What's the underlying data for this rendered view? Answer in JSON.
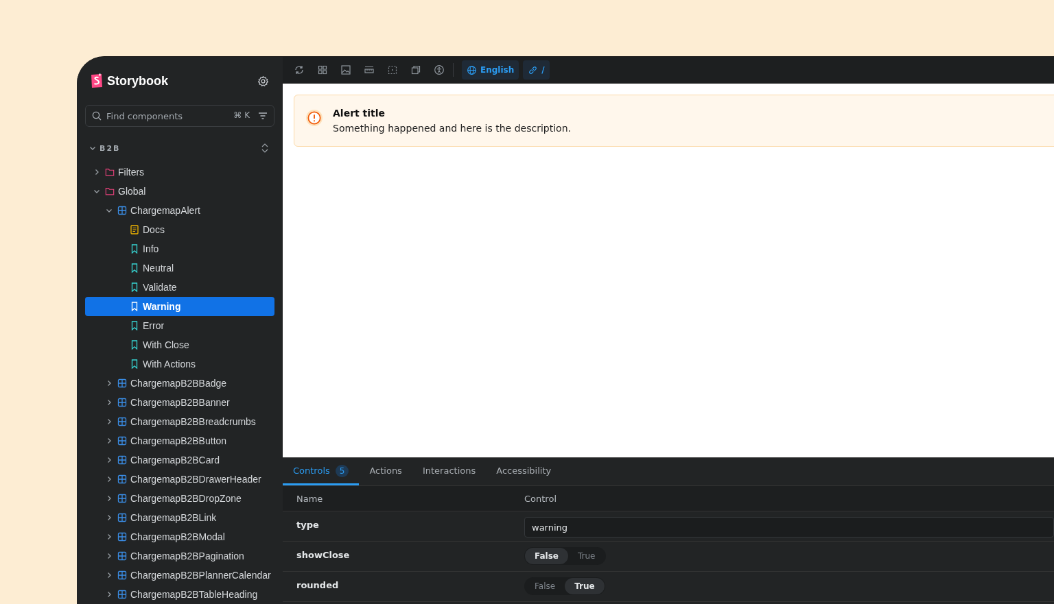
{
  "sidebar": {
    "brand": "Storybook",
    "search": {
      "placeholder": "Find components",
      "shortcut": "⌘ K"
    },
    "section": {
      "label": "B2B",
      "expanded": true
    },
    "tree": [
      {
        "label": "Filters",
        "kind": "folder",
        "expanded": false,
        "selected": false
      },
      {
        "label": "Global",
        "kind": "folder",
        "expanded": true,
        "selected": false,
        "children": [
          {
            "label": "ChargemapAlert",
            "kind": "component",
            "expanded": true,
            "selected": false,
            "children": [
              {
                "label": "Docs",
                "kind": "docs",
                "selected": false
              },
              {
                "label": "Info",
                "kind": "story",
                "selected": false
              },
              {
                "label": "Neutral",
                "kind": "story",
                "selected": false
              },
              {
                "label": "Validate",
                "kind": "story",
                "selected": false
              },
              {
                "label": "Warning",
                "kind": "story",
                "selected": true
              },
              {
                "label": "Error",
                "kind": "story",
                "selected": false
              },
              {
                "label": "With Close",
                "kind": "story",
                "selected": false
              },
              {
                "label": "With Actions",
                "kind": "story",
                "selected": false
              }
            ]
          },
          {
            "label": "ChargemapB2BBadge",
            "kind": "component",
            "expanded": false,
            "selected": false
          },
          {
            "label": "ChargemapB2BBanner",
            "kind": "component",
            "expanded": false,
            "selected": false
          },
          {
            "label": "ChargemapB2BBreadcrumbs",
            "kind": "component",
            "expanded": false,
            "selected": false
          },
          {
            "label": "ChargemapB2BButton",
            "kind": "component",
            "expanded": false,
            "selected": false
          },
          {
            "label": "ChargemapB2BCard",
            "kind": "component",
            "expanded": false,
            "selected": false
          },
          {
            "label": "ChargemapB2BDrawerHeader",
            "kind": "component",
            "expanded": false,
            "selected": false
          },
          {
            "label": "ChargemapB2BDropZone",
            "kind": "component",
            "expanded": false,
            "selected": false
          },
          {
            "label": "ChargemapB2BLink",
            "kind": "component",
            "expanded": false,
            "selected": false
          },
          {
            "label": "ChargemapB2BModal",
            "kind": "component",
            "expanded": false,
            "selected": false
          },
          {
            "label": "ChargemapB2BPagination",
            "kind": "component",
            "expanded": false,
            "selected": false
          },
          {
            "label": "ChargemapB2BPlannerCalendar",
            "kind": "component",
            "expanded": false,
            "selected": false
          },
          {
            "label": "ChargemapB2BTableHeading",
            "kind": "component",
            "expanded": false,
            "selected": false
          }
        ]
      }
    ]
  },
  "toolbar": {
    "language": "English",
    "link": "/"
  },
  "alert": {
    "title": "Alert title",
    "description": "Something happened and here is the description."
  },
  "panel": {
    "tabs": [
      {
        "label": "Controls",
        "badge": "5",
        "selected": true
      },
      {
        "label": "Actions",
        "selected": false
      },
      {
        "label": "Interactions",
        "selected": false
      },
      {
        "label": "Accessibility",
        "selected": false
      }
    ],
    "columns": [
      "Name",
      "Control"
    ],
    "rows": [
      {
        "name": "type",
        "kind": "text",
        "value": "warning"
      },
      {
        "name": "showClose",
        "kind": "boolean",
        "options": [
          {
            "label": "False",
            "selected": true
          },
          {
            "label": "True",
            "selected": false
          }
        ]
      },
      {
        "name": "rounded",
        "kind": "boolean",
        "options": [
          {
            "label": "False",
            "selected": false
          },
          {
            "label": "True",
            "selected": true
          }
        ]
      }
    ]
  }
}
